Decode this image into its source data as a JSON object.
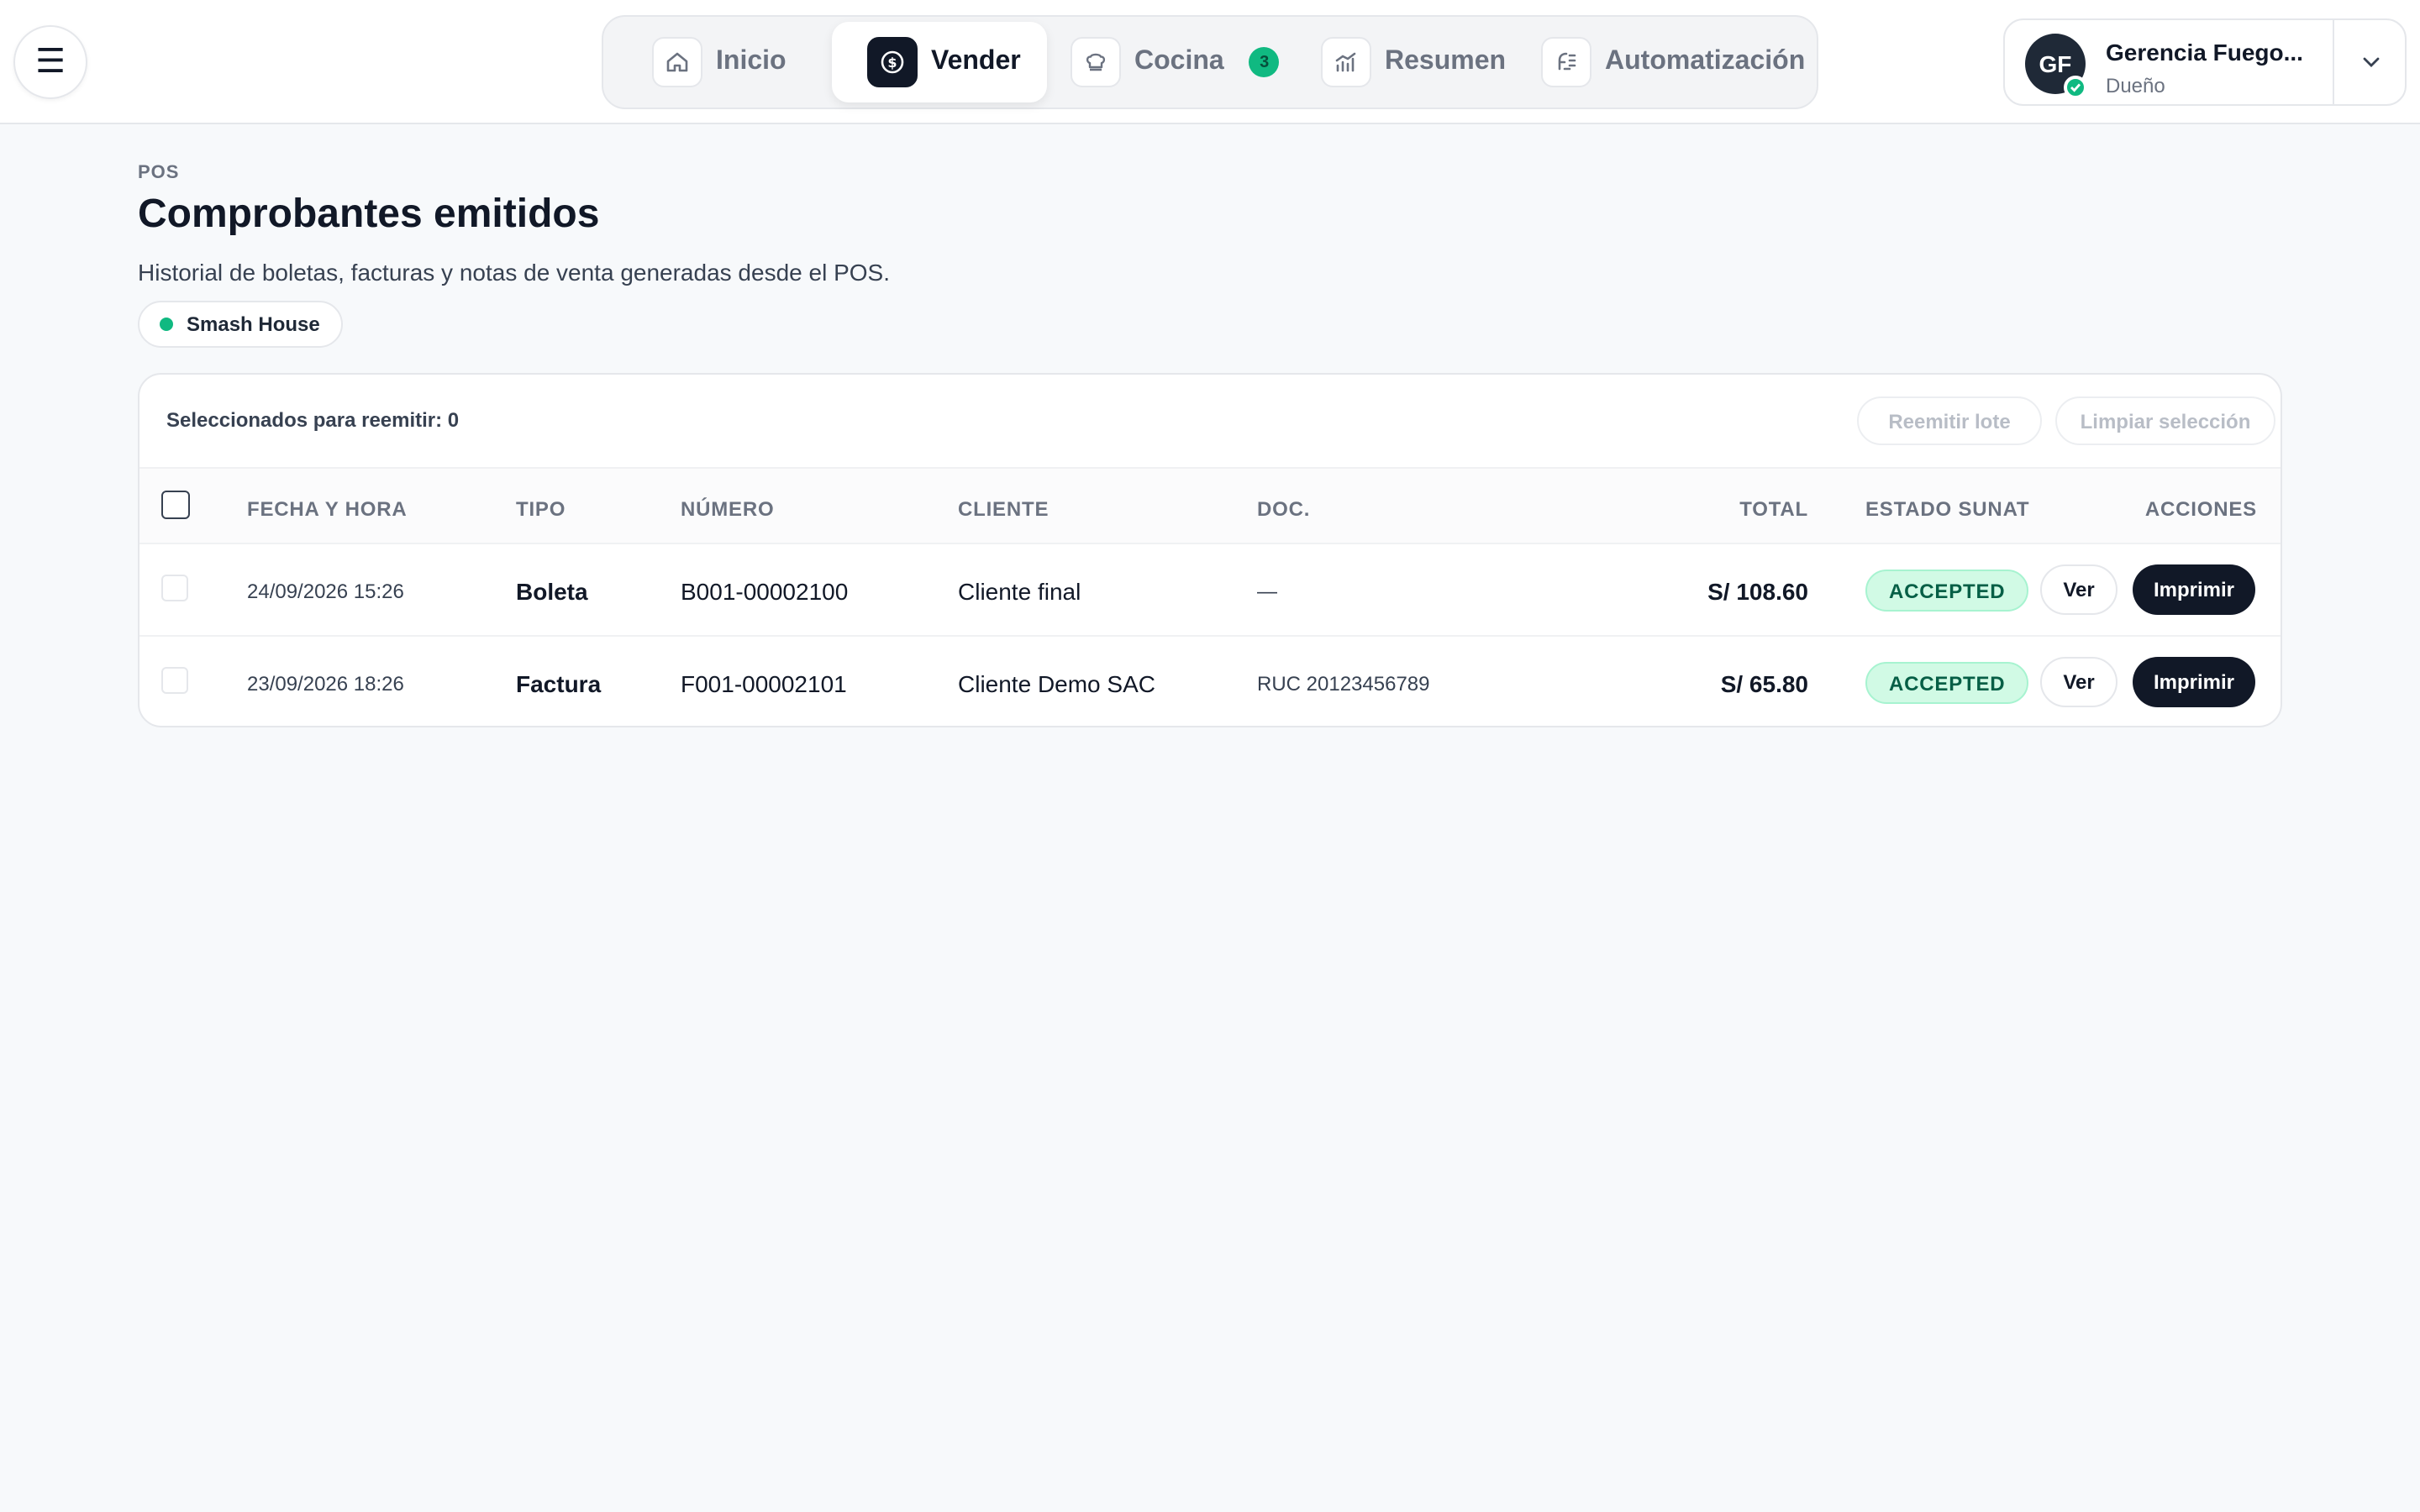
{
  "nav": {
    "menu_icon": "hamburger-icon",
    "items": [
      {
        "label": "Inicio",
        "icon": "home-icon"
      },
      {
        "label": "Vender",
        "icon": "dollar-icon"
      },
      {
        "label": "Cocina",
        "icon": "chef-hat-icon",
        "badge": "3"
      },
      {
        "label": "Resumen",
        "icon": "chart-icon"
      },
      {
        "label": "Automatización",
        "icon": "automation-icon"
      }
    ],
    "active": "Vender"
  },
  "user": {
    "initials": "GF",
    "name": "Gerencia Fuego...",
    "role": "Dueño"
  },
  "header": {
    "eyebrow": "POS",
    "title": "Comprobantes emitidos",
    "subtitle": "Historial de boletas, facturas y notas de venta generadas desde el POS.",
    "store": "Smash House"
  },
  "toolbar": {
    "selected_text": "Seleccionados para reemitir: 0",
    "reissue_label": "Reemitir lote",
    "clear_label": "Limpiar selección"
  },
  "table": {
    "columns": {
      "fecha": "FECHA Y HORA",
      "tipo": "TIPO",
      "numero": "NÚMERO",
      "cliente": "CLIENTE",
      "doc": "DOC.",
      "total": "TOTAL",
      "estado": "ESTADO SUNAT",
      "acciones": "ACCIONES"
    },
    "rows": [
      {
        "fecha": "24/09/2026 15:26",
        "tipo": "Boleta",
        "numero": "B001-00002100",
        "cliente": "Cliente final",
        "doc": "—",
        "total": "S/ 108.60",
        "estado": "ACCEPTED",
        "ver": "Ver",
        "imprimir": "Imprimir"
      },
      {
        "fecha": "23/09/2026 18:26",
        "tipo": "Factura",
        "numero": "F001-00002101",
        "cliente": "Cliente Demo SAC",
        "doc": "RUC 20123456789",
        "total": "S/ 65.80",
        "estado": "ACCEPTED",
        "ver": "Ver",
        "imprimir": "Imprimir"
      }
    ]
  },
  "colors": {
    "accent": "#111827",
    "success": "#10b981",
    "status_bg": "#d1fae5",
    "background": "#f7f9fb"
  }
}
